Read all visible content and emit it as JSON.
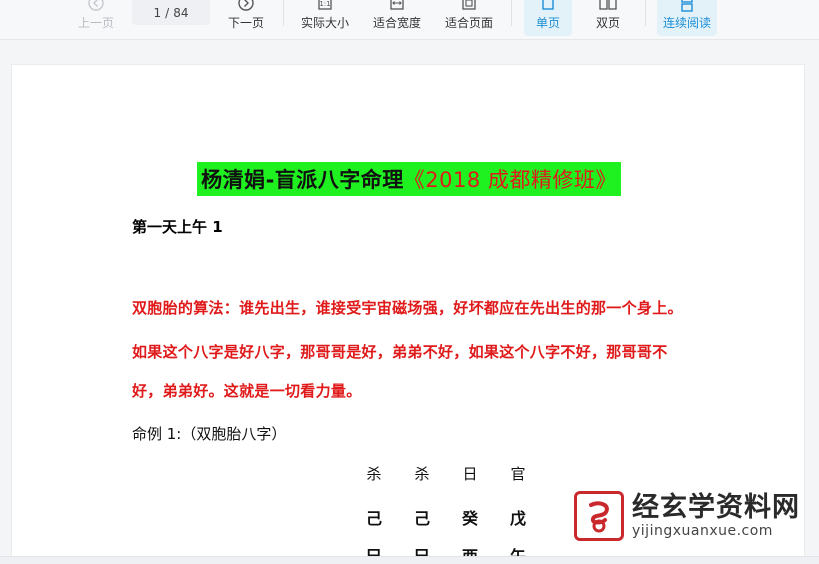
{
  "toolbar": {
    "prev_label": "上一页",
    "page_current": "1",
    "page_sep": "/",
    "page_total": "84",
    "next_label": "下一页",
    "actual_size_label": "实际大小",
    "fit_width_label": "适合宽度",
    "fit_page_label": "适合页面",
    "single_label": "单页",
    "double_label": "双页",
    "continuous_label": "连续阅读",
    "accent_color": "#1d8fd6"
  },
  "document": {
    "title_main": "杨清娟-盲派八字命理",
    "title_bracket": "《2018 成都精修班》",
    "subtitle": "第一天上午 1",
    "para_line1": "双胞胎的算法：谁先出生，谁接受宇宙磁场强，好坏都应在先出生的那一个身上。",
    "para_line2": "如果这个八字是好八字，那哥哥是好，弟弟不好，如果这个八字不好，那哥哥不",
    "para_line3": "好，弟弟好。这就是一切看力量。",
    "case_label": "命例 1:（双胞胎八字）",
    "chart": {
      "row1": [
        "杀",
        "杀",
        "日",
        "官"
      ],
      "row2": [
        "己",
        "己",
        "癸",
        "戊"
      ],
      "row3": [
        "巳",
        "巳",
        "酉",
        "午"
      ]
    }
  },
  "watermark": {
    "name": "经玄学资料网",
    "url": "yijingxuanxue.com"
  }
}
